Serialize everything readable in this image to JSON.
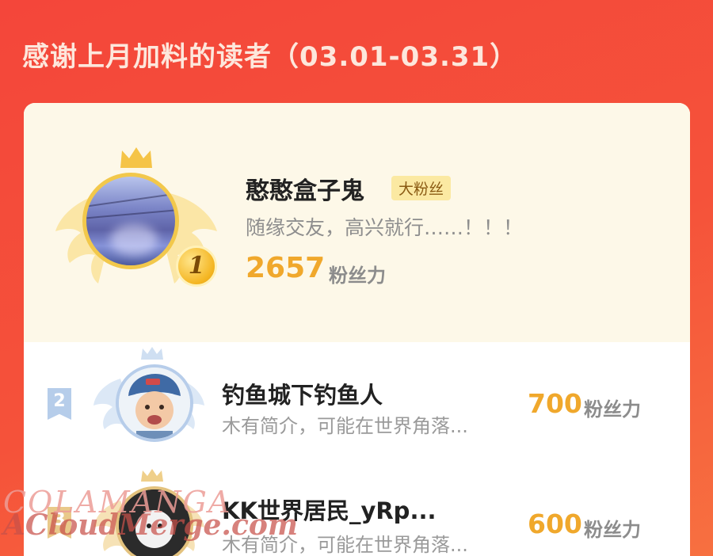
{
  "header": {
    "title": "感谢上月加料的读者（03.01-03.31）"
  },
  "top_reader": {
    "rank": "1",
    "name": "憨憨盒子鬼",
    "tag": "大粉丝",
    "bio": "随缘交友，高兴就行……！！！",
    "score": "2657",
    "unit": "粉丝力",
    "icons": [
      "crown-icon",
      "wings-icon",
      "gold-medal-icon"
    ]
  },
  "readers": [
    {
      "rank": "2",
      "name": "钓鱼城下钓鱼人",
      "bio": "木有简介，可能在世界角落...",
      "score": "700",
      "unit": "粉丝力"
    },
    {
      "rank": "3",
      "name": "KK世界居民_yRp...",
      "bio": "木有简介，可能在世界角落...",
      "score": "600",
      "unit": "粉丝力"
    }
  ],
  "watermark": {
    "line1": "COLAMANGA",
    "line2": "ACloudMerge.com"
  },
  "colors": {
    "background": "#f4463a",
    "gold": "#f0a82c",
    "silver_blue": "#b6cdea",
    "card_top": "#fdf8e8"
  }
}
